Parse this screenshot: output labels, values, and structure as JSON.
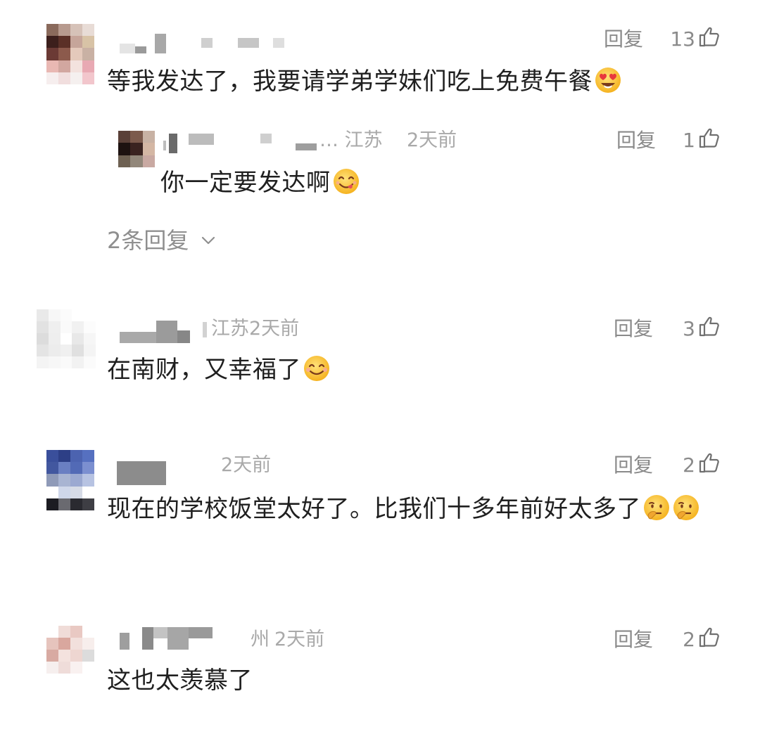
{
  "actions": {
    "reply_label": "回复"
  },
  "comments": [
    {
      "text": "等我发达了，我要请学弟学妹们吃上免费午餐",
      "likes": "13",
      "emoji": "heart-eyes-emoji",
      "replies": [
        {
          "location": "… 江苏",
          "time": "2天前",
          "text": "你一定要发达啊",
          "likes": "1",
          "emoji": "yum-emoji"
        }
      ],
      "more_replies_label": "2条回复"
    },
    {
      "location": "江苏",
      "time": "2天前",
      "text": "在南财，又幸福了",
      "likes": "3",
      "emoji": "smile-emoji"
    },
    {
      "time": "2天前",
      "text": "现在的学校饭堂太好了。比我们十多年前好太多了",
      "likes": "2",
      "emoji": "thinking-emoji"
    },
    {
      "location": "州",
      "time": "2天前",
      "text": "这也太羡慕了",
      "likes": "2"
    }
  ],
  "colors": {
    "text": "#1f1f1f",
    "meta": "#a9a9a9",
    "action": "#8a8a8a",
    "emoji_yellow": "#ffcc33"
  }
}
